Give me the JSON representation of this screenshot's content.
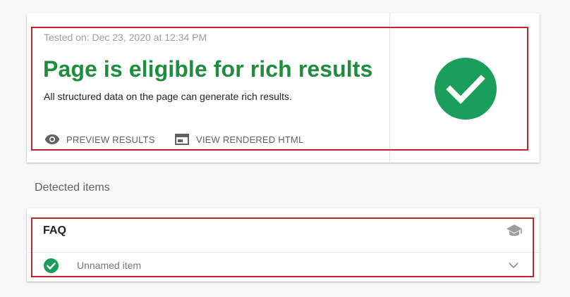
{
  "result": {
    "tested_on": "Tested on: Dec 23, 2020 at 12:34 PM",
    "title": "Page is eligible for rich results",
    "description": "All structured data on the page can generate rich results.",
    "status_icon": "check-circle-icon",
    "actions": [
      {
        "label": "PREVIEW RESULTS",
        "icon": "eye-icon"
      },
      {
        "label": "VIEW RENDERED HTML",
        "icon": "browser-window-icon"
      }
    ]
  },
  "detected": {
    "heading": "Detected items",
    "items": [
      {
        "type": "FAQ",
        "help_icon": "school-cap-icon",
        "rows": [
          {
            "label": "Unnamed item",
            "status_icon": "check-circle-icon",
            "expand_icon": "chevron-down-icon"
          }
        ]
      }
    ]
  },
  "colors": {
    "success_green": "#1e8e3e",
    "check_circle_green": "#1a9e5a",
    "highlight_red": "#c0272d",
    "text_dark": "#212121",
    "text_muted": "#9e9e9e"
  }
}
